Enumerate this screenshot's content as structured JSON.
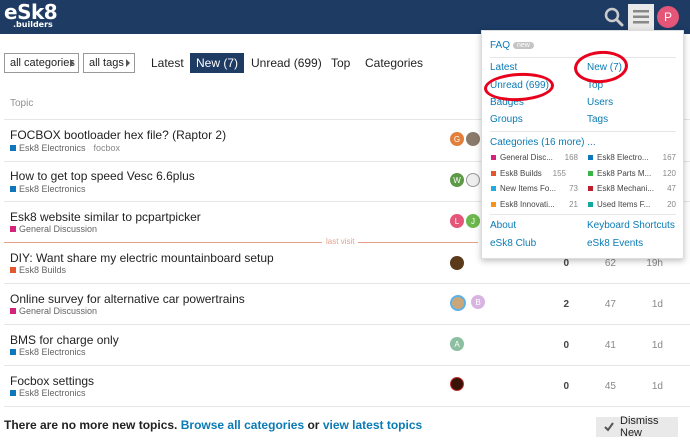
{
  "header": {
    "logo_main": "eSk8",
    "logo_sub": ".builders",
    "avatar_letter": "P"
  },
  "nav": {
    "categories_dropdown": "all categories",
    "tags_dropdown": "all tags",
    "latest": "Latest",
    "new": "New (7)",
    "unread": "Unread (699)",
    "top": "Top",
    "categories": "Categories"
  },
  "table": {
    "col_topic": "Topic",
    "last_visit": "last visit",
    "rows": [
      {
        "title": "FOCBOX bootloader hex file? (Raptor 2)",
        "category": "Esk8 Electronics",
        "cat_color": "#0e76bd",
        "tag": "focbox",
        "replies": "",
        "views": "",
        "activity": ""
      },
      {
        "title": "How to get top speed Vesc 6.6plus",
        "category": "Esk8 Electronics",
        "cat_color": "#0e76bd",
        "tag": "",
        "replies": "",
        "views": "",
        "activity": ""
      },
      {
        "title": "Esk8 website similar to pcpartpicker",
        "category": "General Discussion",
        "cat_color": "#d4237a",
        "tag": "",
        "replies": "",
        "views": "",
        "activity": ""
      },
      {
        "title": "DIY: Want share my electric mountainboard setup",
        "category": "Esk8 Builds",
        "cat_color": "#e4572e",
        "tag": "",
        "replies": "0",
        "views": "62",
        "activity": "19h"
      },
      {
        "title": "Online survey for alternative car powertrains",
        "category": "General Discussion",
        "cat_color": "#d4237a",
        "tag": "",
        "replies": "2",
        "views": "47",
        "activity": "1d"
      },
      {
        "title": "BMS for charge only",
        "category": "Esk8 Electronics",
        "cat_color": "#0e76bd",
        "tag": "",
        "replies": "0",
        "views": "41",
        "activity": "1d"
      },
      {
        "title": "Focbox settings",
        "category": "Esk8 Electronics",
        "cat_color": "#0e76bd",
        "tag": "",
        "replies": "0",
        "views": "45",
        "activity": "1d"
      }
    ],
    "avatar_letters": [
      "G",
      "W",
      "L",
      "J",
      "B",
      "A"
    ]
  },
  "footer": {
    "prefix": "There are no more new topics.",
    "browse_link": "Browse all categories",
    "or": "or",
    "latest_link": "view latest topics",
    "dismiss": "Dismiss New"
  },
  "menu": {
    "faq": "FAQ",
    "faq_badge": "new",
    "latest": "Latest",
    "new": "New (7)",
    "unread": "Unread (699)",
    "top": "Top",
    "badges": "Badges",
    "users": "Users",
    "groups": "Groups",
    "tags": "Tags",
    "categories_header": "Categories (16 more) ...",
    "categories": [
      {
        "name": "General Disc...",
        "count": "168",
        "color": "#d4237a"
      },
      {
        "name": "Esk8 Electro...",
        "count": "167",
        "color": "#0e76bd"
      },
      {
        "name": "Esk8 Builds",
        "count": "155",
        "color": "#e4572e"
      },
      {
        "name": "Esk8 Parts M...",
        "count": "120",
        "color": "#3ab54a"
      },
      {
        "name": "New Items Fo...",
        "count": "73",
        "color": "#25aae1"
      },
      {
        "name": "Esk8 Mechani...",
        "count": "47",
        "color": "#bf1e2e"
      },
      {
        "name": "Esk8 Innovati...",
        "count": "21",
        "color": "#f7941d"
      },
      {
        "name": "Used Items F...",
        "count": "20",
        "color": "#12a89d"
      }
    ],
    "about": "About",
    "keyboard": "Keyboard Shortcuts",
    "club": "eSk8 Club",
    "events": "eSk8 Events"
  }
}
